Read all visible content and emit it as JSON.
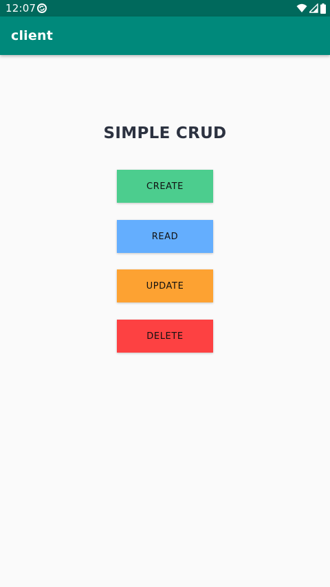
{
  "status_bar": {
    "time": "12:07",
    "icons": [
      "sync-notification-icon",
      "wifi-icon",
      "signal-icon",
      "battery-icon"
    ]
  },
  "app_bar": {
    "title": "client"
  },
  "main": {
    "heading": "SIMPLE CRUD",
    "buttons": {
      "create": "CREATE",
      "read": "READ",
      "update": "UPDATE",
      "delete": "DELETE"
    }
  },
  "colors": {
    "status_bar": "#00695c",
    "app_bar": "#00897b",
    "background": "#fafafa",
    "create": "#4ccd8e",
    "read": "#64aefe",
    "update": "#fda232",
    "delete": "#fd4142"
  }
}
